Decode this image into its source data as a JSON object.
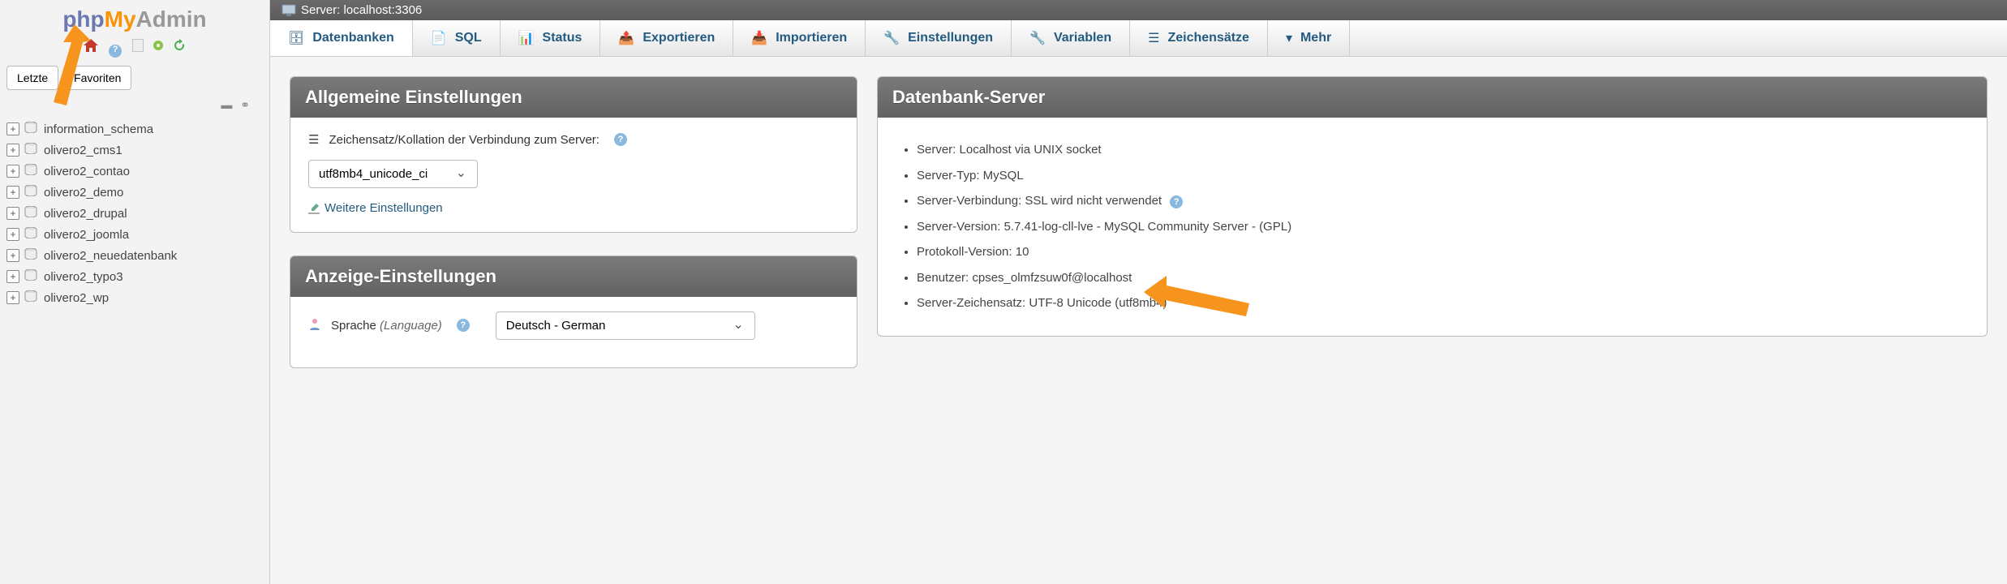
{
  "logo": {
    "p1": "php",
    "p2": "My",
    "p3": "Admin"
  },
  "sidebar": {
    "tabs": {
      "recent": "Letzte",
      "favorites": "Favoriten"
    },
    "databases": [
      "information_schema",
      "olivero2_cms1",
      "olivero2_contao",
      "olivero2_demo",
      "olivero2_drupal",
      "olivero2_joomla",
      "olivero2_neuedatenbank",
      "olivero2_typo3",
      "olivero2_wp"
    ]
  },
  "topbar": {
    "label": "Server: localhost:3306"
  },
  "tabs": [
    {
      "label": "Datenbanken"
    },
    {
      "label": "SQL"
    },
    {
      "label": "Status"
    },
    {
      "label": "Exportieren"
    },
    {
      "label": "Importieren"
    },
    {
      "label": "Einstellungen"
    },
    {
      "label": "Variablen"
    },
    {
      "label": "Zeichensätze"
    },
    {
      "label": "Mehr"
    }
  ],
  "panels": {
    "general": {
      "title": "Allgemeine Einstellungen",
      "charset_label": "Zeichensatz/Kollation der Verbindung zum Server:",
      "charset_value": "utf8mb4_unicode_ci",
      "more_link": "Weitere Einstellungen"
    },
    "display": {
      "title": "Anzeige-Einstellungen",
      "lang_label": "Sprache ",
      "lang_hint": "(Language)",
      "lang_value": "Deutsch - German"
    },
    "server": {
      "title": "Datenbank-Server",
      "items": [
        "Server: Localhost via UNIX socket",
        "Server-Typ: MySQL",
        "Server-Verbindung: SSL wird nicht verwendet",
        "Server-Version: 5.7.41-log-cll-lve - MySQL Community Server - (GPL)",
        "Protokoll-Version: 10",
        "Benutzer: cpses_olmfzsuw0f@localhost",
        "Server-Zeichensatz: UTF-8 Unicode (utf8mb4)"
      ]
    }
  }
}
